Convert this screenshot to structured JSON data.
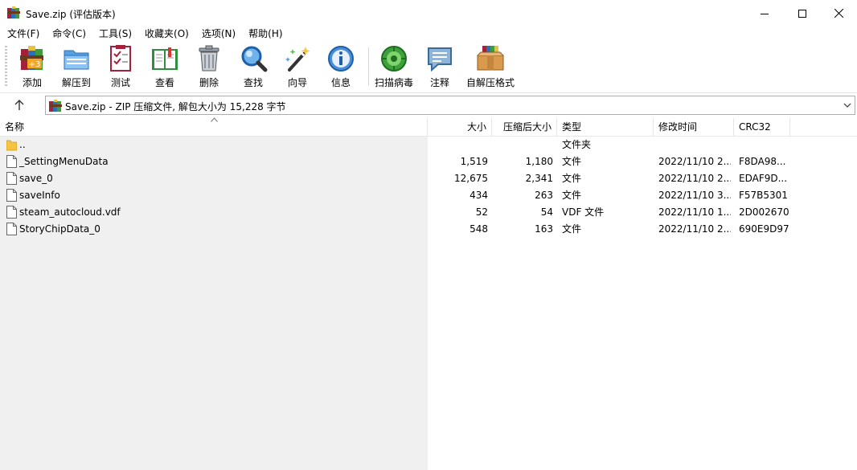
{
  "window": {
    "title": "Save.zip (评估版本)"
  },
  "menu": [
    "文件(F)",
    "命令(C)",
    "工具(S)",
    "收藏夹(O)",
    "选项(N)",
    "帮助(H)"
  ],
  "toolbar": {
    "add": "添加",
    "extract": "解压到",
    "test": "测试",
    "view": "查看",
    "delete": "删除",
    "find": "查找",
    "wizard": "向导",
    "info": "信息",
    "scan": "扫描病毒",
    "comment": "注释",
    "sfx": "自解压格式"
  },
  "address": {
    "text": "Save.zip - ZIP 压缩文件, 解包大小为 15,228 字节"
  },
  "columns": {
    "name": "名称",
    "size": "大小",
    "packed": "压缩后大小",
    "type": "类型",
    "modified": "修改时间",
    "crc": "CRC32"
  },
  "files": [
    {
      "name": "..",
      "size": "",
      "packed": "",
      "type": "文件夹",
      "modified": "",
      "crc": ""
    },
    {
      "name": "_SettingMenuData",
      "size": "1,519",
      "packed": "1,180",
      "type": "文件",
      "modified": "2022/11/10 2...",
      "crc": "F8DA98..."
    },
    {
      "name": "save_0",
      "size": "12,675",
      "packed": "2,341",
      "type": "文件",
      "modified": "2022/11/10 2...",
      "crc": "EDAF9D..."
    },
    {
      "name": "saveInfo",
      "size": "434",
      "packed": "263",
      "type": "文件",
      "modified": "2022/11/10 3...",
      "crc": "F57B5301"
    },
    {
      "name": "steam_autocloud.vdf",
      "size": "52",
      "packed": "54",
      "type": "VDF 文件",
      "modified": "2022/11/10 1...",
      "crc": "2D002670"
    },
    {
      "name": "StoryChipData_0",
      "size": "548",
      "packed": "163",
      "type": "文件",
      "modified": "2022/11/10 2...",
      "crc": "690E9D97"
    }
  ],
  "colors": {
    "selected_pane": "#f0f0f0",
    "folder": "#f5c542"
  }
}
